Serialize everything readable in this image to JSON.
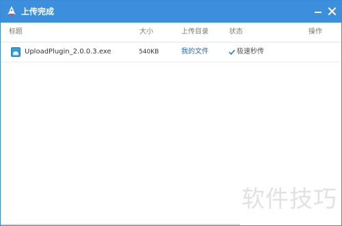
{
  "window": {
    "title": "上传完成",
    "icons": {
      "app": "rocket-upload-icon",
      "minimize": "minimize-icon",
      "close": "close-icon"
    },
    "colors": {
      "titlebar": "#3b8fdc",
      "link": "#1f6fb8",
      "check": "#3a8ad6"
    }
  },
  "table": {
    "columns": {
      "title": "标题",
      "size": "大小",
      "dir": "上传目录",
      "status": "状态",
      "op": "操作"
    },
    "rows": [
      {
        "name": "UploadPlugin_2.0.0.3.exe",
        "size": "540KB",
        "dir": "我的文件",
        "status": "极速秒传",
        "file_icon": "installer-file-icon",
        "status_icon": "check-icon"
      }
    ]
  },
  "watermark": "软件技巧"
}
